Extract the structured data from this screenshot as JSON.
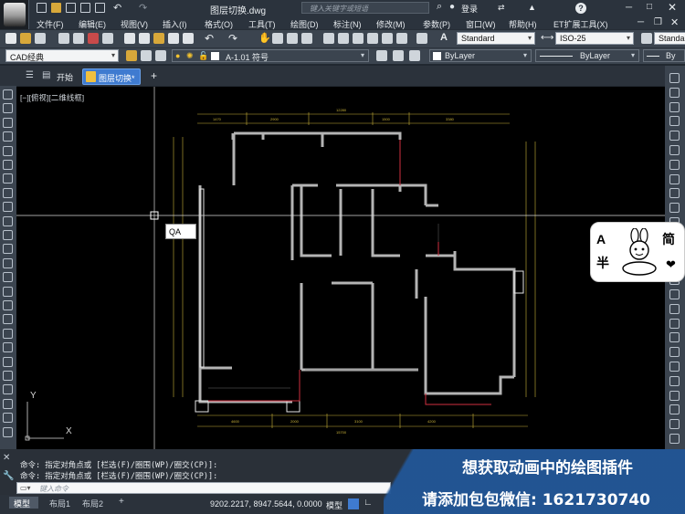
{
  "window": {
    "file_title": "图层切换.dwg",
    "search_placeholder": "键入关键字或短语",
    "login_label": "登录",
    "help_label": "?"
  },
  "menu": {
    "items": [
      "文件(F)",
      "编辑(E)",
      "视图(V)",
      "插入(I)",
      "格式(O)",
      "工具(T)",
      "绘图(D)",
      "标注(N)",
      "修改(M)",
      "参数(P)",
      "窗口(W)",
      "帮助(H)",
      "ET扩展工具(X)"
    ]
  },
  "toolbar": {
    "text_style": "Standard",
    "dim_style": "ISO-25",
    "table_style": "Standa",
    "workspace": "CAD经典",
    "layer_name": "A-1.01 符号",
    "color": "ByLayer",
    "linetype": "ByLayer",
    "lineweight": "By"
  },
  "tabs": {
    "start_label": "开始",
    "active_label": "图层切换*",
    "add_label": "+"
  },
  "viewport": {
    "label": "[−][俯视][二维线框]",
    "cursor_input": "QA",
    "ucs_x": "X",
    "ucs_y": "Y"
  },
  "command": {
    "line1": "命令: 指定对角点或 [栏选(F)/圈围(WP)/圈交(CP)]:",
    "line2": "命令: 指定对角点或 [栏选(F)/圈围(WP)/圈交(CP)]:",
    "placeholder": "键入命令"
  },
  "status": {
    "tabs": [
      "模型",
      "布局1",
      "布局2"
    ],
    "add_label": "+",
    "coords": "9202.2217, 8947.5644, 0.0000",
    "model_label": "模型"
  },
  "promo": {
    "line1": "想获取动画中的绘图插件",
    "line2": "请添加包包微信: 1621730740"
  },
  "sticker": {
    "left_top": "A",
    "left_bottom": "半",
    "right_top": "简",
    "heart": "❤"
  },
  "colors": {
    "accent_blue": "#3f7bd0",
    "wall_gray": "#b4b4b4",
    "dim_yellow": "#c9b23a",
    "wall_red": "#d03040",
    "promo_blue": "#2256a0"
  }
}
